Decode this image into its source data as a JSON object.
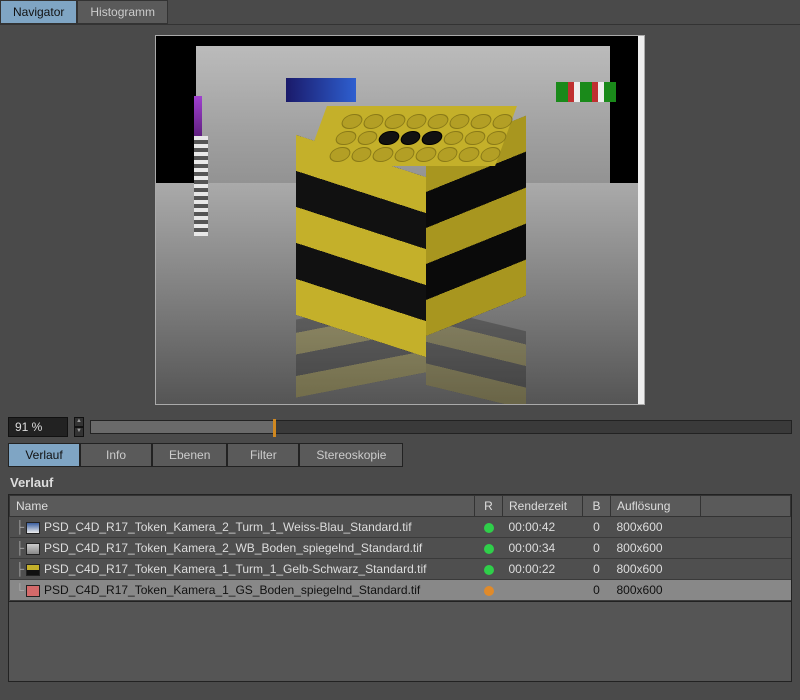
{
  "top_tabs": {
    "navigator": "Navigator",
    "histogram": "Histogramm",
    "active": "navigator"
  },
  "zoom": {
    "value": "91 %",
    "percent": 26
  },
  "sub_tabs": {
    "items": [
      "Verlauf",
      "Info",
      "Ebenen",
      "Filter",
      "Stereoskopie"
    ],
    "active_index": 0
  },
  "section_title": "Verlauf",
  "table": {
    "columns": {
      "name": "Name",
      "r": "R",
      "rendertime": "Renderzeit",
      "b": "B",
      "resolution": "Auflösung"
    },
    "rows": [
      {
        "icon": "thumb1",
        "branch": "├",
        "name": "PSD_C4D_R17_Token_Kamera_2_Turm_1_Weiss-Blau_Standard.tif",
        "status": "green",
        "rendertime": "00:00:42",
        "b": "0",
        "resolution": "800x600",
        "selected": false
      },
      {
        "icon": "thumb2",
        "branch": "├",
        "name": "PSD_C4D_R17_Token_Kamera_2_WB_Boden_spiegelnd_Standard.tif",
        "status": "green",
        "rendertime": "00:00:34",
        "b": "0",
        "resolution": "800x600",
        "selected": false
      },
      {
        "icon": "thumb3",
        "branch": "├",
        "name": "PSD_C4D_R17_Token_Kamera_1_Turm_1_Gelb-Schwarz_Standard.tif",
        "status": "green",
        "rendertime": "00:00:22",
        "b": "0",
        "resolution": "800x600",
        "selected": false
      },
      {
        "icon": "thumb4",
        "branch": "└",
        "name": "PSD_C4D_R17_Token_Kamera_1_GS_Boden_spiegelnd_Standard.tif",
        "status": "orange",
        "rendertime": "",
        "b": "0",
        "resolution": "800x600",
        "selected": true
      }
    ]
  },
  "colors": {
    "accent_tab": "#7fa5c4",
    "status_green": "#2fcf4a",
    "status_orange": "#e08a2a"
  }
}
